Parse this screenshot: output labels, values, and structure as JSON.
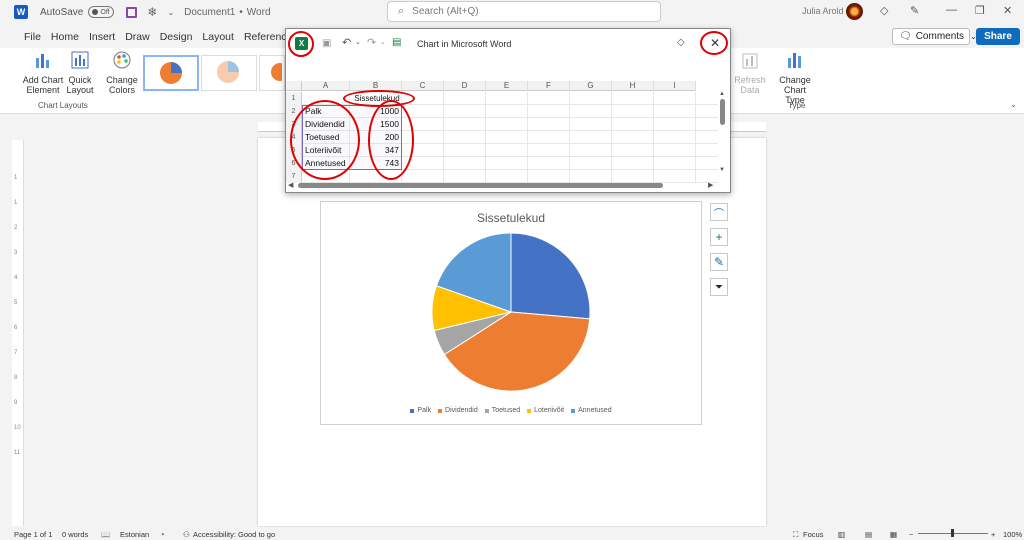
{
  "titlebar": {
    "app_logo": "W",
    "autosave_label": "AutoSave",
    "autosave_state": "Off",
    "document_name": "Document1",
    "separator": "•",
    "app_name": "Word",
    "search_placeholder": "Search (Alt+Q)",
    "user_name": "Julia Arold"
  },
  "menu": {
    "tabs": [
      "File",
      "Home",
      "Insert",
      "Draw",
      "Design",
      "Layout",
      "References"
    ],
    "comments_label": "Comments",
    "share_label": "Share"
  },
  "ribbon": {
    "add_chart_element": "Add Chart Element",
    "quick_layout": "Quick Layout",
    "change_colors": "Change Colors",
    "group_chart_layouts": "Chart Layouts",
    "refresh_data": "Refresh Data",
    "change_chart_type": "Change Chart Type",
    "group_type": "Type"
  },
  "popup": {
    "title": "Chart in Microsoft Word",
    "excel_logo": "X",
    "columns": [
      "A",
      "B",
      "C",
      "D",
      "E",
      "F",
      "G",
      "H",
      "I"
    ],
    "rows": [
      "1",
      "2",
      "3",
      "4",
      "5",
      "6",
      "7"
    ],
    "header_b1": "Sissetulekud",
    "labels": [
      "Palk",
      "Dividendid",
      "Toetused",
      "Loteriivõit",
      "Annetused"
    ],
    "values": [
      "1000",
      "1500",
      "200",
      "347",
      "743"
    ]
  },
  "chart_data": {
    "type": "pie",
    "title": "Sissetulekud",
    "categories": [
      "Palk",
      "Dividendid",
      "Toetused",
      "Loteriivõit",
      "Annetused"
    ],
    "values": [
      1000,
      1500,
      200,
      347,
      743
    ],
    "colors": [
      "#4472c4",
      "#ed7d31",
      "#a5a5a5",
      "#ffc000",
      "#5b9bd5"
    ],
    "legend_position": "bottom"
  },
  "statusbar": {
    "page": "Page 1 of 1",
    "words": "0 words",
    "language": "Estonian",
    "accessibility": "Accessibility: Good to go",
    "focus": "Focus",
    "zoom": "100%"
  }
}
